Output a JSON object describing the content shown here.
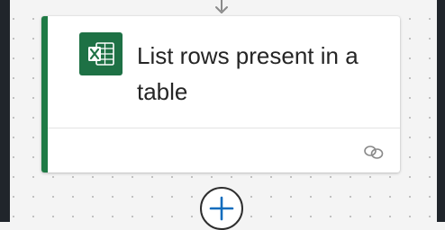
{
  "action_card": {
    "title": "List rows present in a table",
    "connector_icon": "excel-icon",
    "accent_color": "#1f7a45",
    "footer_icon": "link-icon"
  },
  "add_step": {
    "icon": "plus-icon",
    "color": "#0f6cbd"
  }
}
